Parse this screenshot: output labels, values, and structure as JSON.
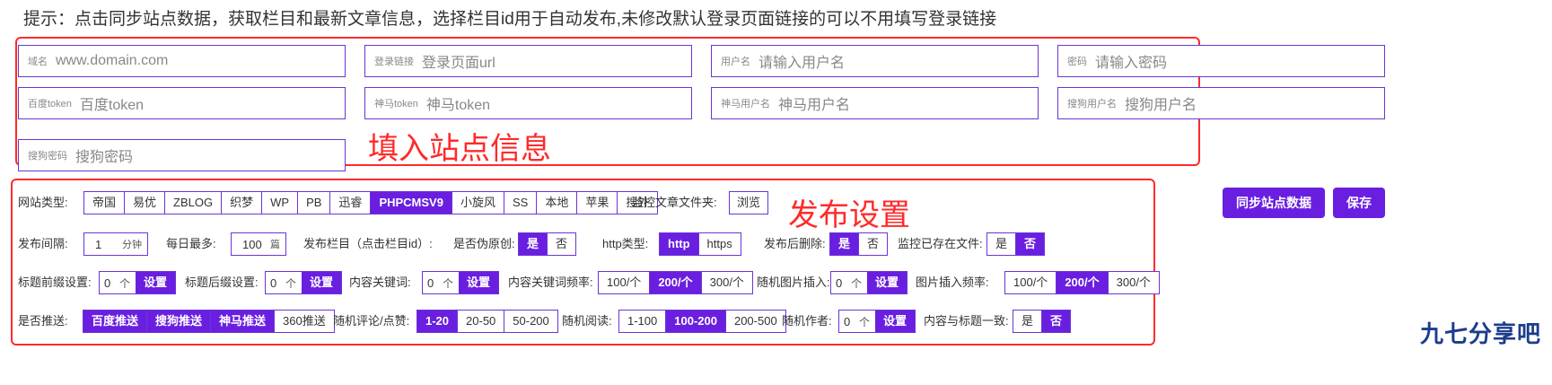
{
  "hint": "提示：点击同步站点数据，获取栏目和最新文章信息，选择栏目id用于自动发布,未修改默认登录页面链接的可以不用填写登录链接",
  "site_info": {
    "section_label": "填入站点信息",
    "fields": [
      {
        "label": "域名",
        "placeholder": "www.domain.com"
      },
      {
        "label": "登录链接",
        "placeholder": "登录页面url"
      },
      {
        "label": "用户名",
        "placeholder": "请输入用户名"
      },
      {
        "label": "密码",
        "placeholder": "请输入密码"
      },
      {
        "label": "百度token",
        "placeholder": "百度token"
      },
      {
        "label": "神马token",
        "placeholder": "神马token"
      },
      {
        "label": "神马用户名",
        "placeholder": "神马用户名"
      },
      {
        "label": "搜狗用户名",
        "placeholder": "搜狗用户名"
      },
      {
        "label": "搜狗密码",
        "placeholder": "搜狗密码"
      }
    ]
  },
  "publish": {
    "section_label": "发布设置",
    "site_type": {
      "label": "网站类型:",
      "options": [
        "帝国",
        "易优",
        "ZBLOG",
        "织梦",
        "WP",
        "PB",
        "迅睿",
        "PHPCMSV9",
        "小旋风",
        "SS",
        "本地",
        "苹果",
        "搜外"
      ],
      "selected": "PHPCMSV9"
    },
    "monitor_folder": {
      "label": "监控文章文件夹:",
      "button": "浏览"
    },
    "interval": {
      "label": "发布间隔:",
      "value": "1",
      "unit": "分钟"
    },
    "daily_max": {
      "label": "每日最多:",
      "value": "100",
      "unit": "篇"
    },
    "column": {
      "label": "发布栏目（点击栏目id）:"
    },
    "pseudo_original": {
      "label": "是否伪原创:",
      "options": [
        "是",
        "否"
      ],
      "selected": "是"
    },
    "http_type": {
      "label": "http类型:",
      "options": [
        "http",
        "https"
      ],
      "selected": "http"
    },
    "delete_after": {
      "label": "发布后删除:",
      "options": [
        "是",
        "否"
      ],
      "selected": "是"
    },
    "monitor_existing": {
      "label": "监控已存在文件:",
      "options": [
        "是",
        "否"
      ],
      "selected": "否"
    },
    "title_prefix": {
      "label": "标题前缀设置:",
      "value": "0",
      "unit": "个",
      "button": "设置"
    },
    "title_suffix": {
      "label": "标题后缀设置:",
      "value": "0",
      "unit": "个",
      "button": "设置"
    },
    "content_keywords": {
      "label": "内容关键词:",
      "value": "0",
      "unit": "个",
      "button": "设置"
    },
    "keyword_freq": {
      "label": "内容关键词频率:",
      "options": [
        "100/个",
        "200/个",
        "300/个"
      ],
      "selected": "200/个"
    },
    "random_image": {
      "label": "随机图片插入:",
      "value": "0",
      "unit": "个",
      "button": "设置"
    },
    "image_freq": {
      "label": "图片插入频率:",
      "options": [
        "100/个",
        "200/个",
        "300/个"
      ],
      "selected": "200/个"
    },
    "push": {
      "label": "是否推送:",
      "options": [
        "百度推送",
        "搜狗推送",
        "神马推送",
        "360推送"
      ],
      "selected": [
        "百度推送",
        "搜狗推送",
        "神马推送"
      ]
    },
    "random_comments": {
      "label": "随机评论/点赞:",
      "options": [
        "1-20",
        "20-50",
        "50-200"
      ],
      "selected": "1-20"
    },
    "random_reads": {
      "label": "随机阅读:",
      "options": [
        "1-100",
        "100-200",
        "200-500"
      ],
      "selected": "100-200"
    },
    "random_author": {
      "label": "随机作者:",
      "value": "0",
      "unit": "个",
      "button": "设置"
    },
    "title_match": {
      "label": "内容与标题一致:",
      "options": [
        "是",
        "否"
      ],
      "selected": "否"
    }
  },
  "actions": {
    "sync": "同步站点数据",
    "save": "保存"
  },
  "watermark": "九七分享吧",
  "colors": {
    "accent": "#6a1fe0",
    "annotation": "#ff2a2a"
  }
}
